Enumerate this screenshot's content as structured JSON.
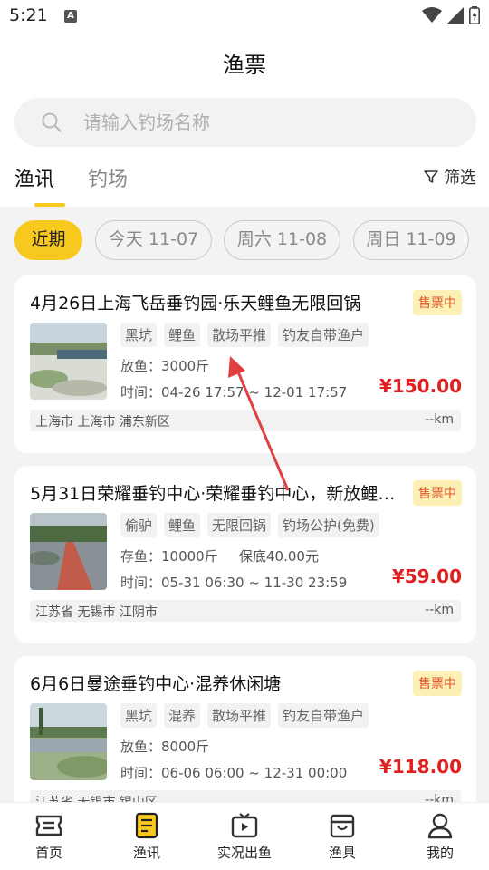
{
  "status": {
    "time": "5:21",
    "a_badge": "A"
  },
  "header": {
    "title": "渔票"
  },
  "search": {
    "placeholder": "请输入钓场名称"
  },
  "tabs": [
    {
      "label": "渔讯"
    },
    {
      "label": "钓场"
    }
  ],
  "filter": {
    "label": "筛选"
  },
  "chips": [
    "近期",
    "今天 11-07",
    "周六 11-08",
    "周日 11-09"
  ],
  "accent": "#f7c81e",
  "price_color": "#e02020",
  "cards": [
    {
      "title": "4月26日上海飞岳垂钓园·乐天鲤鱼无限回锅",
      "badge": "售票中",
      "tags": [
        "黑坑",
        "鲤鱼",
        "散场平推",
        "钓友自带渔户"
      ],
      "info1": "放鱼：3000斤",
      "info1b": "",
      "info2": "时间：04-26 17:57 ~ 12-01 17:57",
      "price": "¥150.00",
      "location": "上海市 上海市 浦东新区",
      "distance": "--km"
    },
    {
      "title": "5月31日荣耀垂钓中心·荣耀垂钓中心，新放鲤鱼…",
      "badge": "售票中",
      "tags": [
        "偷驴",
        "鲤鱼",
        "无限回锅",
        "钓场公护(免费)"
      ],
      "info1": "存鱼：10000斤",
      "info1b": "保底40.00元",
      "info2": "时间：05-31 06:30 ~ 11-30 23:59",
      "price": "¥59.00",
      "location": "江苏省 无锡市 江阴市",
      "distance": "--km"
    },
    {
      "title": "6月6日曼途垂钓中心·混养休闲塘",
      "badge": "售票中",
      "tags": [
        "黑坑",
        "混养",
        "散场平推",
        "钓友自带渔户"
      ],
      "info1": "放鱼：8000斤",
      "info1b": "",
      "info2": "时间：06-06 06:00 ~ 12-31 00:00",
      "price": "¥118.00",
      "location": "江苏省 无锡市 锡山区",
      "distance": "--km"
    }
  ],
  "bottom_nav": [
    {
      "label": "首页",
      "icon": "ticket-icon"
    },
    {
      "label": "渔讯",
      "icon": "news-icon"
    },
    {
      "label": "实况出鱼",
      "icon": "live-tv-icon"
    },
    {
      "label": "渔具",
      "icon": "shop-icon"
    },
    {
      "label": "我的",
      "icon": "profile-icon"
    }
  ]
}
